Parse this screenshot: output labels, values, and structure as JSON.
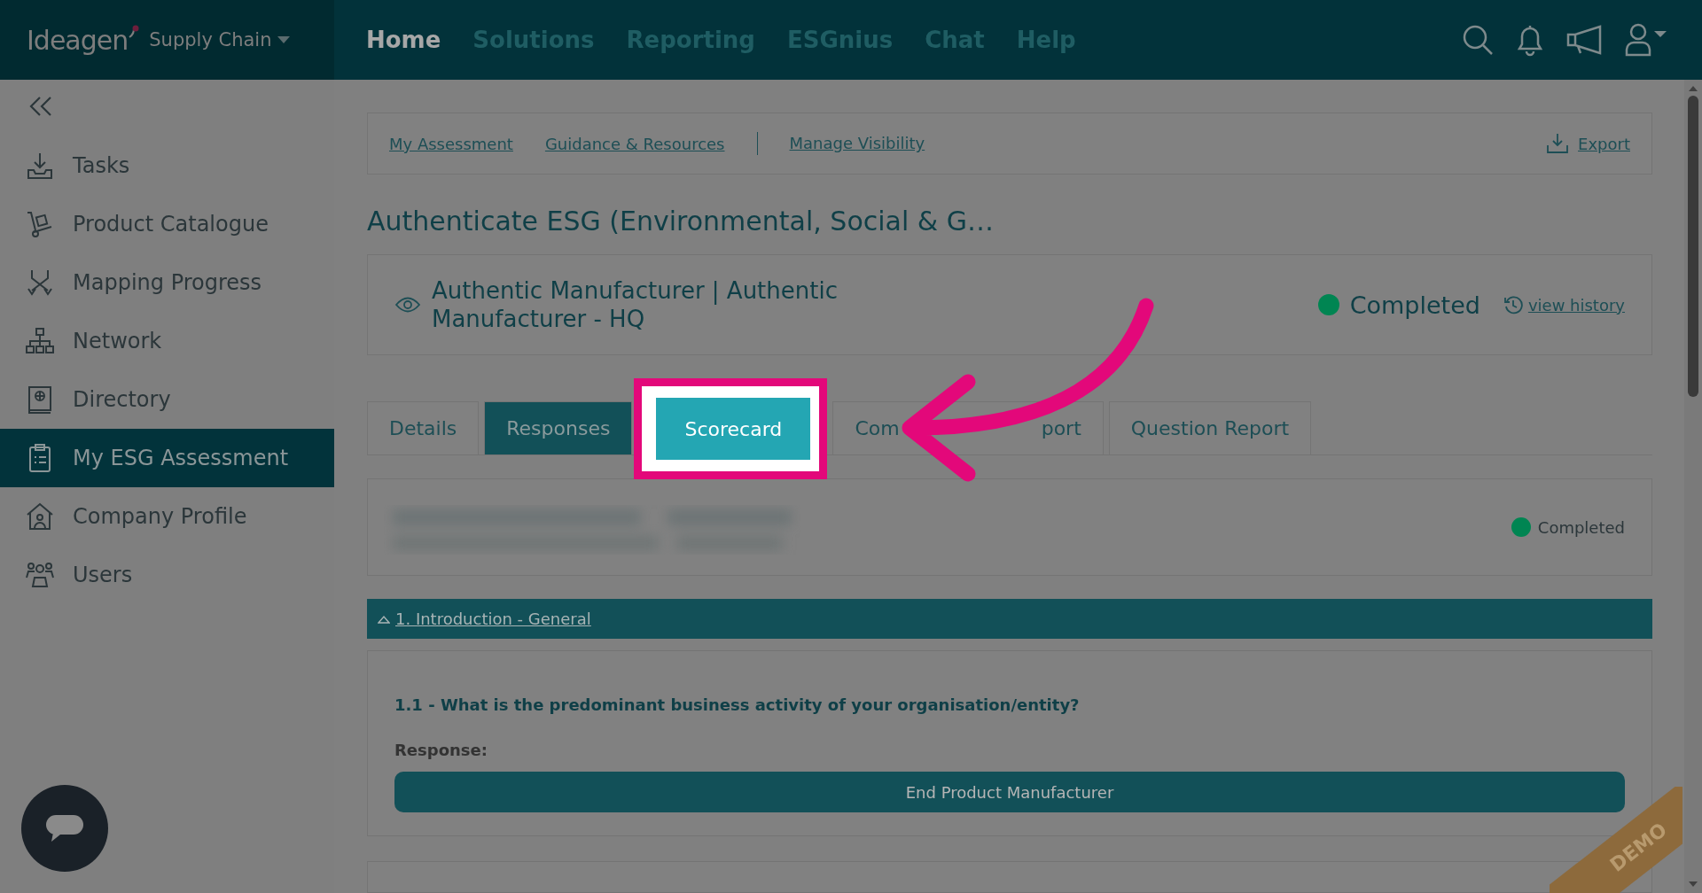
{
  "brand": {
    "logo": "Ideagen",
    "product": "Supply Chain"
  },
  "nav": [
    {
      "label": "Home",
      "selected": true
    },
    {
      "label": "Solutions",
      "selected": false
    },
    {
      "label": "Reporting",
      "selected": false
    },
    {
      "label": "ESGnius",
      "selected": false
    },
    {
      "label": "Chat",
      "selected": false
    },
    {
      "label": "Help",
      "selected": false
    }
  ],
  "sidebar": {
    "items": [
      {
        "label": "Tasks",
        "selected": false
      },
      {
        "label": "Product Catalogue",
        "selected": false
      },
      {
        "label": "Mapping Progress",
        "selected": false
      },
      {
        "label": "Network",
        "selected": false
      },
      {
        "label": "Directory",
        "selected": false
      },
      {
        "label": "My ESG Assessment",
        "selected": true
      },
      {
        "label": "Company Profile",
        "selected": false
      },
      {
        "label": "Users",
        "selected": false
      }
    ]
  },
  "subnav": {
    "links": [
      "My Assessment",
      "Guidance & Resources",
      "Manage Visibility"
    ],
    "export": "Export"
  },
  "title": "Authenticate ESG (Environmental, Social & G…",
  "org": {
    "name": "Authentic Manufacturer | Authentic Manufacturer - HQ",
    "status": "Completed",
    "history": "view history"
  },
  "tabs": [
    {
      "kind": "text",
      "label": "Details",
      "selected": false,
      "highlighted": false
    },
    {
      "kind": "text",
      "label": "Responses",
      "selected": true,
      "highlighted": false
    },
    {
      "kind": "text",
      "label": "Scorecard",
      "selected": false,
      "highlighted": true
    },
    {
      "kind": "split",
      "parts": [
        "Com",
        "port"
      ],
      "selected": false,
      "highlighted": false
    },
    {
      "kind": "text",
      "label": "Question Report",
      "selected": false,
      "highlighted": false
    }
  ],
  "status_card": {
    "status": "Completed"
  },
  "section": {
    "title": "1. Introduction - General",
    "expanded": true
  },
  "question": {
    "text": "1.1 - What is the predominant business activity of your organisation/entity?",
    "response_label": "Response:",
    "answer": "End Product Manufacturer"
  },
  "badge": "DEMO"
}
